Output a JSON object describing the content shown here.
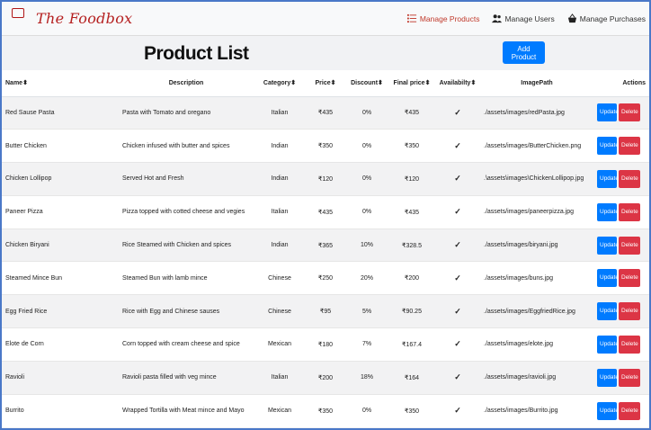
{
  "brand": {
    "badge_text": "The Food Box",
    "name": "The Foodbox"
  },
  "nav": {
    "manage_products": "Manage Products",
    "manage_users": "Manage Users",
    "manage_purchases": "Manage Purchases",
    "active_color": "#c0392b"
  },
  "page": {
    "title": "Product List",
    "add_button": "Add Product"
  },
  "table": {
    "headers": {
      "name": "Name",
      "description": "Description",
      "category": "Category",
      "price": "Price",
      "discount": "Discount",
      "final_price": "Final price",
      "availability": "Availabilty",
      "image_path": "ImagePath",
      "actions": "Actions",
      "sort_indicator": "⬍"
    },
    "rows": [
      {
        "name": "Red Sause Pasta",
        "description": "Pasta with Tomato and oregano",
        "category": "Italian",
        "price": "₹435",
        "discount": "0%",
        "final_price": "₹435",
        "available": "✓",
        "image_path": "./assets/images/redPasta.jpg"
      },
      {
        "name": "Butter Chicken",
        "description": "Chicken infused with butter and spices",
        "category": "Indian",
        "price": "₹350",
        "discount": "0%",
        "final_price": "₹350",
        "available": "✓",
        "image_path": "./assets/images/ButterChicken.png"
      },
      {
        "name": "Chicken Lollipop",
        "description": "Served Hot and Fresh",
        "category": "Indian",
        "price": "₹120",
        "discount": "0%",
        "final_price": "₹120",
        "available": "✓",
        "image_path": ".\\assets\\images\\ChickenLollipop.jpg"
      },
      {
        "name": "Paneer Pizza",
        "description": "Pizza topped with cotted cheese and vegies",
        "category": "Italian",
        "price": "₹435",
        "discount": "0%",
        "final_price": "₹435",
        "available": "✓",
        "image_path": "./assets/images/paneerpizza.jpg"
      },
      {
        "name": "Chicken Biryani",
        "description": "Rice Steamed with Chicken and spices",
        "category": "Indian",
        "price": "₹365",
        "discount": "10%",
        "final_price": "₹328.5",
        "available": "✓",
        "image_path": "./assets/images/biryani.jpg"
      },
      {
        "name": "Steamed Mince Bun",
        "description": "Steamed Bun with lamb mince",
        "category": "Chinese",
        "price": "₹250",
        "discount": "20%",
        "final_price": "₹200",
        "available": "✓",
        "image_path": "./assets/images/buns.jpg"
      },
      {
        "name": "Egg Fried Rice",
        "description": "Rice with Egg and Chinese sauses",
        "category": "Chinese",
        "price": "₹95",
        "discount": "5%",
        "final_price": "₹90.25",
        "available": "✓",
        "image_path": "./assets/images/EggfriedRice.jpg"
      },
      {
        "name": "Elote de Corn",
        "description": "Corn topped with cream cheese and spice",
        "category": "Mexican",
        "price": "₹180",
        "discount": "7%",
        "final_price": "₹167.4",
        "available": "✓",
        "image_path": "./assets/images/elote.jpg"
      },
      {
        "name": "Ravioli",
        "description": "Ravioli pasta filled with veg mince",
        "category": "Italian",
        "price": "₹200",
        "discount": "18%",
        "final_price": "₹164",
        "available": "✓",
        "image_path": "./assets/images/ravioli.jpg"
      },
      {
        "name": "Burrito",
        "description": "Wrapped Tortilla with Meat mince and Mayo",
        "category": "Mexican",
        "price": "₹350",
        "discount": "0%",
        "final_price": "₹350",
        "available": "✓",
        "image_path": "./assets/images/Burrito.jpg"
      }
    ],
    "update_label": "Update",
    "delete_label": "Delete"
  },
  "colors": {
    "primary": "#007bff",
    "danger": "#dc3545",
    "brand": "#b52020",
    "frame_border": "#4a78c8"
  }
}
